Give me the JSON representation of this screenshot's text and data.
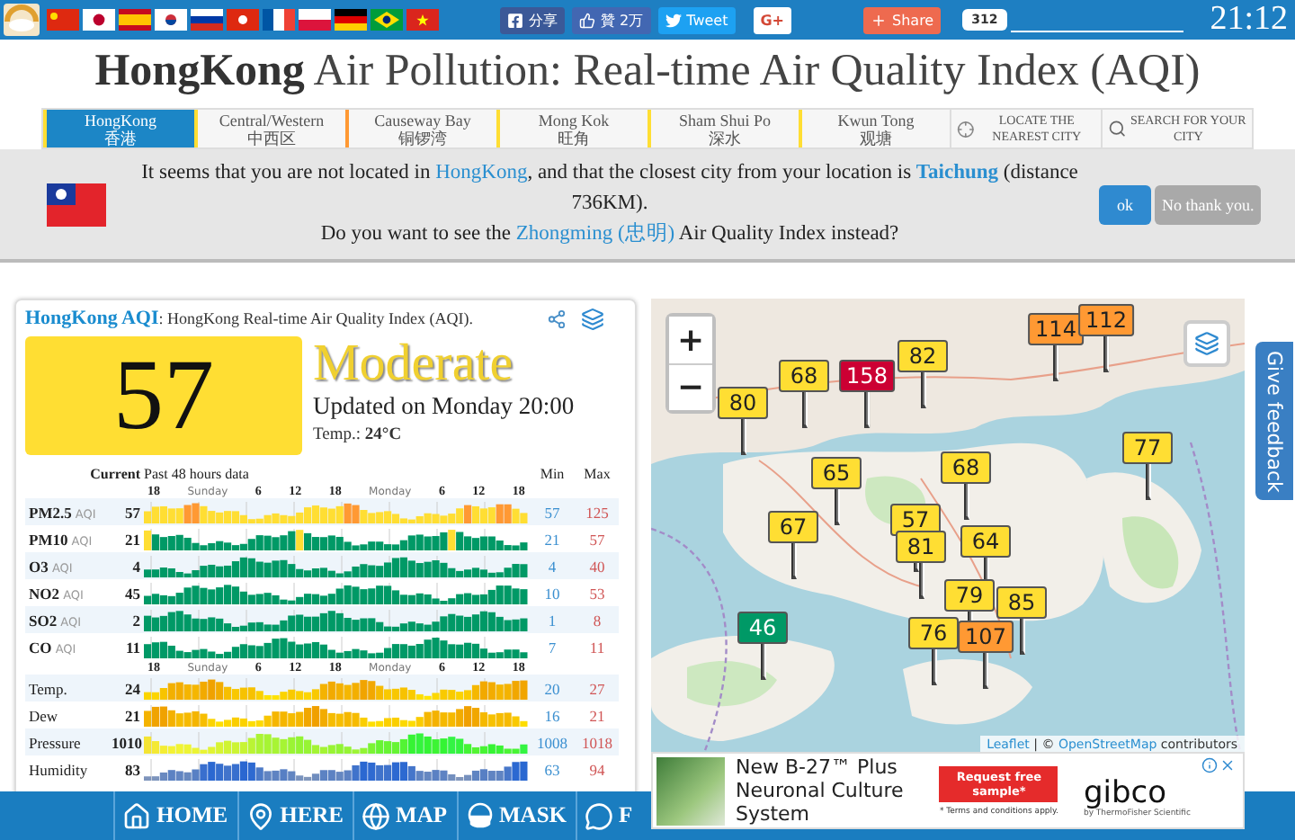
{
  "top_bar": {
    "share_buttons": [
      {
        "kind": "facebook",
        "label": "分享"
      },
      {
        "kind": "like",
        "label": "贊 2万"
      },
      {
        "kind": "twitter",
        "label": "Tweet"
      },
      {
        "kind": "gplus",
        "label": "G+"
      },
      {
        "kind": "share",
        "label": "Share",
        "count": "312"
      }
    ],
    "time": "21:12"
  },
  "title": "**HongKong** Air Pollution: Real-time Air Quality Index (AQI)",
  "city_tabs": [
    {
      "name": "HongKong",
      "local": "香港",
      "selected": true,
      "color": "#ffde33"
    },
    {
      "name": "Central/Western",
      "local": "中西区",
      "selected": false,
      "color": "#ffde33"
    },
    {
      "name": "Causeway Bay",
      "local": "铜锣湾",
      "selected": false,
      "color": "#ff9933"
    },
    {
      "name": "Mong Kok",
      "local": "旺角",
      "selected": false,
      "color": "#ffde33"
    },
    {
      "name": "Sham Shui Po",
      "local": "深水",
      "selected": false,
      "color": "#ffde33"
    },
    {
      "name": "Kwun Tong",
      "local": "观塘",
      "selected": false,
      "color": "#ffde33"
    }
  ],
  "tools": [
    {
      "kind": "locate",
      "label": "LOCATE THE NEAREST CITY"
    },
    {
      "kind": "search",
      "label": "SEARCH FOR YOUR CITY"
    }
  ],
  "notice": {
    "lines": [
      [
        {
          "kind": "text",
          "text": "It seems that you are not located in "
        },
        {
          "kind": "link",
          "text": "HongKong"
        },
        {
          "kind": "text",
          "text": ", and that the closest city from your location is "
        },
        {
          "kind": "strong_link",
          "text": "Taichung"
        },
        {
          "kind": "text",
          "text": " (distance 736KM)."
        }
      ],
      [
        {
          "kind": "text",
          "text": "Do you want to see the "
        },
        {
          "kind": "link",
          "text": "Zhongming (忠明)"
        },
        {
          "kind": "text",
          "text": " Air Quality Index instead?"
        }
      ]
    ],
    "buttons": [
      {
        "kind": "primary",
        "label": "ok"
      },
      {
        "kind": "secondary",
        "label": "No thank you."
      }
    ]
  },
  "aqi_card": {
    "title": "HongKong AQI",
    "subtitle": ": HongKong Real-time Air Quality Index (AQI).",
    "aqi": "57",
    "level": "Moderate",
    "updated": "Updated on Monday 20:00",
    "temp": "Temp.: **24°C**",
    "history": {
      "current": "Current",
      "period": "Past 48 hours data",
      "min": "Min",
      "max": "Max",
      "sections": [
        {
          "axis": [
            {
              "kind": "hour",
              "label": "18"
            },
            {
              "kind": "day",
              "label": "Sunday"
            },
            {
              "kind": "hour",
              "label": "6"
            },
            {
              "kind": "hour",
              "label": "12"
            },
            {
              "kind": "hour",
              "label": "18"
            },
            {
              "kind": "day",
              "label": "Monday"
            },
            {
              "kind": "hour",
              "label": "6"
            },
            {
              "kind": "hour",
              "label": "12"
            },
            {
              "kind": "hour",
              "label": "18"
            }
          ],
          "rows": [
            {
              "kind": "aqi",
              "name": "PM2.5",
              "unit": "AQI",
              "current": "57",
              "min": "57",
              "max": "125"
            },
            {
              "kind": "aqi",
              "name": "PM10",
              "unit": "AQI",
              "current": "21",
              "min": "21",
              "max": "57"
            },
            {
              "kind": "aqi",
              "name": "O3",
              "unit": "AQI",
              "current": "4",
              "min": "4",
              "max": "40"
            },
            {
              "kind": "aqi",
              "name": "NO2",
              "unit": "AQI",
              "current": "45",
              "min": "10",
              "max": "53"
            },
            {
              "kind": "aqi",
              "name": "SO2",
              "unit": "AQI",
              "current": "2",
              "min": "1",
              "max": "8"
            },
            {
              "kind": "aqi",
              "name": "CO",
              "unit": "AQI",
              "current": "11",
              "min": "7",
              "max": "11"
            }
          ]
        },
        {
          "axis": [
            {
              "kind": "hour",
              "label": "18"
            },
            {
              "kind": "day",
              "label": "Sunday"
            },
            {
              "kind": "hour",
              "label": "6"
            },
            {
              "kind": "hour",
              "label": "12"
            },
            {
              "kind": "hour",
              "label": "18"
            },
            {
              "kind": "day",
              "label": "Monday"
            },
            {
              "kind": "hour",
              "label": "6"
            },
            {
              "kind": "hour",
              "label": "12"
            },
            {
              "kind": "hour",
              "label": "18"
            }
          ],
          "rows": [
            {
              "kind": "temp",
              "name": "Temp.",
              "current": "24",
              "min": "20",
              "max": "27"
            },
            {
              "kind": "temp",
              "name": "Dew",
              "current": "21",
              "min": "16",
              "max": "21"
            },
            {
              "kind": "pressure",
              "name": "Pressure",
              "current": "1010",
              "min": "1008",
              "max": "1018"
            },
            {
              "kind": "humidity",
              "name": "Humidity",
              "current": "83",
              "min": "63",
              "max": "94"
            }
          ]
        }
      ]
    }
  },
  "map": {
    "zoom_in": "+",
    "zoom_out": "−",
    "markers": [
      {
        "value": "114",
        "color": "#ff9933"
      },
      {
        "value": "112",
        "color": "#ff9933"
      },
      {
        "value": "82",
        "color": "#ffde33"
      },
      {
        "value": "158",
        "color": "#cc0033"
      },
      {
        "value": "68",
        "color": "#ffde33"
      },
      {
        "value": "80",
        "color": "#ffde33"
      },
      {
        "value": "77",
        "color": "#ffde33"
      },
      {
        "value": "65",
        "color": "#ffde33"
      },
      {
        "value": "68",
        "color": "#ffde33"
      },
      {
        "value": "57",
        "color": "#ffde33"
      },
      {
        "value": "67",
        "color": "#ffde33"
      },
      {
        "value": "81",
        "color": "#ffde33"
      },
      {
        "value": "64",
        "color": "#ffde33"
      },
      {
        "value": "79",
        "color": "#ffde33"
      },
      {
        "value": "85",
        "color": "#ffde33"
      },
      {
        "value": "46",
        "color": "#009966"
      },
      {
        "value": "76",
        "color": "#ffde33"
      },
      {
        "value": "107",
        "color": "#ff9933"
      }
    ],
    "attribution": [
      {
        "kind": "link",
        "text": "Leaflet"
      },
      {
        "kind": "text",
        "text": " | © "
      },
      {
        "kind": "link",
        "text": "OpenStreetMap"
      },
      {
        "kind": "text",
        "text": " contributors"
      }
    ]
  },
  "feedback": "Give feedback",
  "ad": {
    "headline": "New B-27™ Plus Neuronal Culture System",
    "button": "Request free sample*",
    "terms": "* Terms and conditions apply.",
    "brand": "gibco",
    "brand_sub": "by ThermoFisher Scientific"
  },
  "bottom_nav": [
    {
      "kind": "home",
      "label": "HOME"
    },
    {
      "kind": "here",
      "label": "HERE"
    },
    {
      "kind": "map",
      "label": "MAP"
    },
    {
      "kind": "mask",
      "label": "MASK"
    },
    {
      "kind": "faq",
      "label": "F"
    }
  ]
}
